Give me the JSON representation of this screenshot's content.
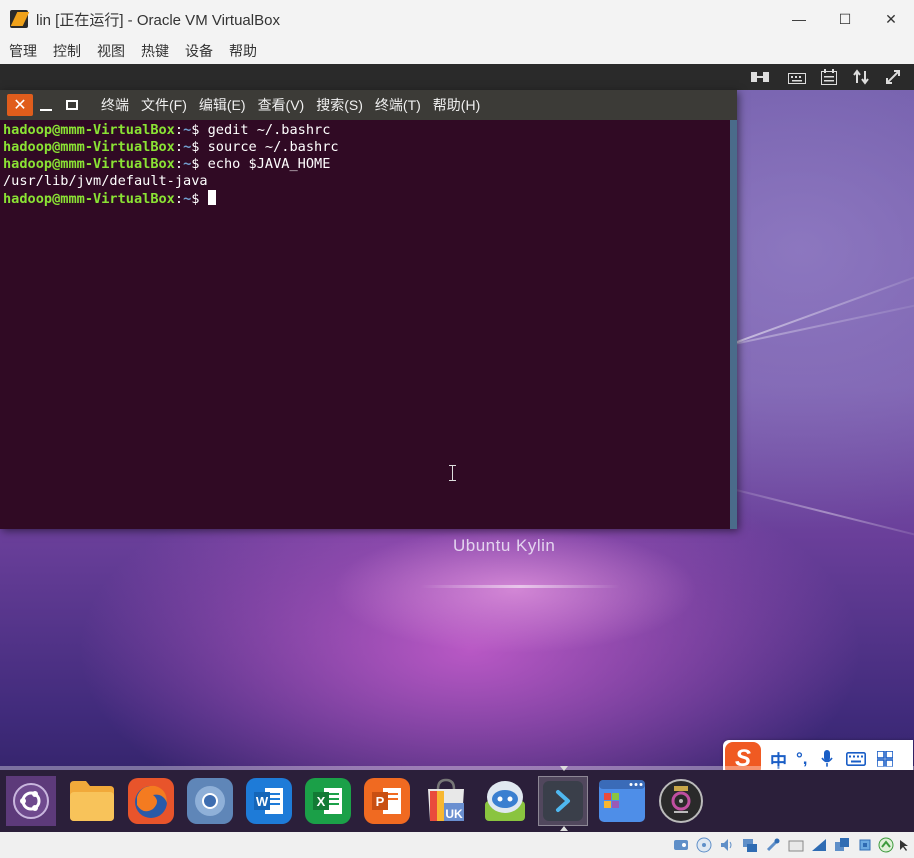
{
  "host": {
    "title": "lin [正在运行] - Oracle VM VirtualBox",
    "window_controls": [
      "—",
      "☐",
      "✕"
    ],
    "menu": [
      "管理",
      "控制",
      "视图",
      "热键",
      "设备",
      "帮助"
    ]
  },
  "vm_toolbar": {
    "icons": [
      "scale-mode-icon",
      "keyboard-icon",
      "soft-keyboard-icon",
      "swap-icon",
      "resize-icon"
    ]
  },
  "terminal": {
    "close_glyph": "✕",
    "menu": [
      "终端",
      "文件(F)",
      "编辑(E)",
      "查看(V)",
      "搜索(S)",
      "终端(T)",
      "帮助(H)"
    ],
    "lines": [
      {
        "user": "hadoop@mmm-VirtualBox",
        "path": "~",
        "cmd": "$ gedit ~/.bashrc"
      },
      {
        "user": "hadoop@mmm-VirtualBox",
        "path": "~",
        "cmd": "$ source ~/.bashrc"
      },
      {
        "user": "hadoop@mmm-VirtualBox",
        "path": "~",
        "cmd": "$ echo $JAVA_HOME"
      },
      {
        "output": "/usr/lib/jvm/default-java"
      },
      {
        "user": "hadoop@mmm-VirtualBox",
        "path": "~",
        "cmd": "$ "
      }
    ]
  },
  "desktop": {
    "brand": "Ubuntu Kylin"
  },
  "ime": {
    "logo": "S",
    "mode": "中",
    "punct": "°,",
    "icons": [
      "mic-icon",
      "keyboard-icon",
      "grid-icon"
    ]
  },
  "dock": {
    "items": [
      {
        "name": "ubuntu-kylin-menu-icon"
      },
      {
        "name": "files-icon"
      },
      {
        "name": "firefox-icon"
      },
      {
        "name": "chromium-icon"
      },
      {
        "name": "wps-writer-icon",
        "label": "W"
      },
      {
        "name": "wps-spreadsheet-icon",
        "label": "X"
      },
      {
        "name": "wps-presentation-icon",
        "label": "P"
      },
      {
        "name": "software-center-icon",
        "label": "UK"
      },
      {
        "name": "kylin-assistant-icon"
      },
      {
        "name": "terminal-icon"
      },
      {
        "name": "workspace-switcher-icon"
      },
      {
        "name": "dvd-icon"
      }
    ],
    "active": "terminal-icon"
  },
  "host_status": {
    "icons": [
      "hdd-icon",
      "optical-icon",
      "audio-icon",
      "network-icon",
      "usb-icon",
      "shared-folders-icon",
      "display-icon",
      "recording-icon",
      "cpu-icon",
      "arrow-icon",
      "mouse-integration-icon",
      "host-key-icon"
    ]
  }
}
